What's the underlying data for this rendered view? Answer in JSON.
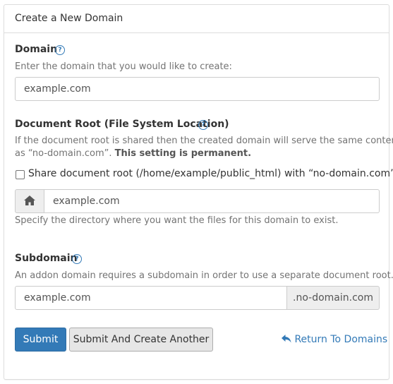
{
  "panel": {
    "title": "Create a New Domain"
  },
  "domain": {
    "label": "Domain",
    "help_icon": "?",
    "hint": "Enter the domain that you would like to create:",
    "value": "example.com"
  },
  "docroot": {
    "label": "Document Root (File System Location)",
    "help_icon": "?",
    "hint_line1": "If the document root is shared then the created domain will serve the same content",
    "hint_line2_prefix": "as “no-domain.com”. ",
    "hint_line2_bold": "This setting is permanent.",
    "share_checkbox_label": "Share document root (/home/example/public_html) with “no-domain.com”.",
    "share_checked": false,
    "home_icon": "house-icon",
    "value": "example.com",
    "footer_hint": "Specify the directory where you want the files for this domain to exist."
  },
  "subdomain": {
    "label": "Subdomain",
    "help_icon": "?",
    "hint": "An addon domain requires a subdomain in order to use a separate document root.",
    "value": "example.com",
    "suffix": ".no-domain.com"
  },
  "actions": {
    "submit": "Submit",
    "submit_another": "Submit And Create Another",
    "return_icon": "reply-arrow-icon",
    "return_link": "Return To Domains"
  },
  "colors": {
    "primary": "#337ab7",
    "border": "#cccccc",
    "addon_bg": "#eeeeee"
  }
}
